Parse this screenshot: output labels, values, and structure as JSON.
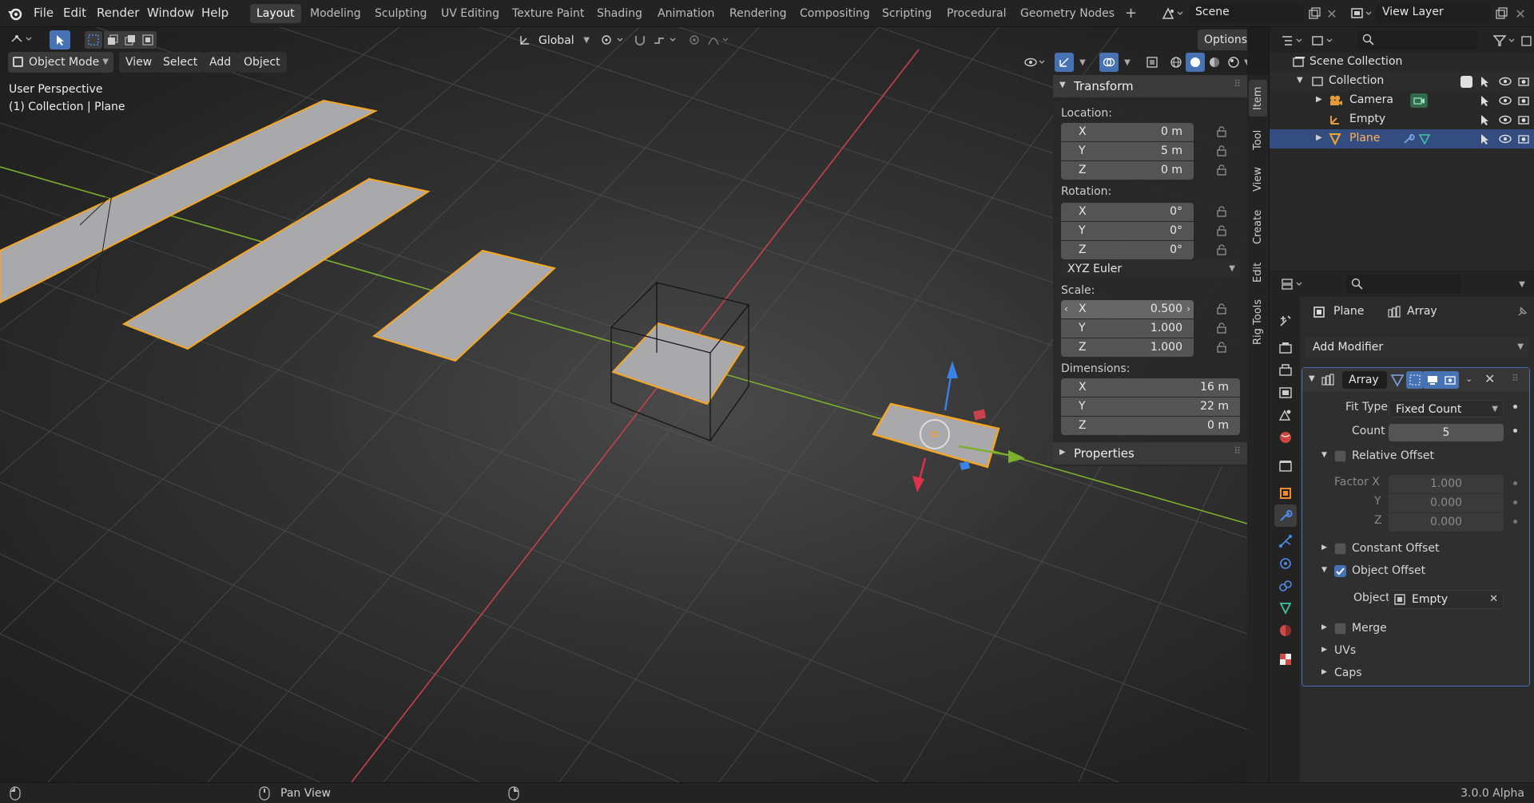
{
  "menu": [
    "File",
    "Edit",
    "Render",
    "Window",
    "Help"
  ],
  "workspaces": [
    "Layout",
    "Modeling",
    "Sculpting",
    "UV Editing",
    "Texture Paint",
    "Shading",
    "Animation",
    "Rendering",
    "Compositing",
    "Scripting",
    "Procedural",
    "Geometry Nodes"
  ],
  "active_workspace": "Layout",
  "scene": "Scene",
  "view_layer": "View Layer",
  "header": {
    "transform_orientation": "Global",
    "options": "Options"
  },
  "viewport_header": {
    "mode": "Object Mode",
    "view": "View",
    "select": "Select",
    "add": "Add",
    "object": "Object"
  },
  "viewport_info": {
    "perspective": "User Perspective",
    "collection": "(1) Collection | Plane"
  },
  "npanel": {
    "tabs": [
      "Item",
      "Tool",
      "View",
      "Create",
      "Edit",
      "Rig Tools"
    ],
    "transform_title": "Transform",
    "location_label": "Location:",
    "location": [
      {
        "axis": "X",
        "value": "0 m"
      },
      {
        "axis": "Y",
        "value": "5 m"
      },
      {
        "axis": "Z",
        "value": "0 m"
      }
    ],
    "rotation_label": "Rotation:",
    "rotation": [
      {
        "axis": "X",
        "value": "0°"
      },
      {
        "axis": "Y",
        "value": "0°"
      },
      {
        "axis": "Z",
        "value": "0°"
      }
    ],
    "rotation_mode": "XYZ Euler",
    "scale_label": "Scale:",
    "scale": [
      {
        "axis": "X",
        "value": "0.500"
      },
      {
        "axis": "Y",
        "value": "1.000"
      },
      {
        "axis": "Z",
        "value": "1.000"
      }
    ],
    "dimensions_label": "Dimensions:",
    "dimensions": [
      {
        "axis": "X",
        "value": "16 m"
      },
      {
        "axis": "Y",
        "value": "22 m"
      },
      {
        "axis": "Z",
        "value": "0 m"
      }
    ],
    "properties_title": "Properties"
  },
  "outliner": {
    "root": "Scene Collection",
    "collection": "Collection",
    "items": [
      "Camera",
      "Empty",
      "Plane"
    ]
  },
  "properties": {
    "object_name": "Plane",
    "modifier_name_crumb": "Array",
    "add_modifier": "Add Modifier",
    "modifier_name": "Array",
    "fit_type_label": "Fit Type",
    "fit_type": "Fixed Count",
    "count_label": "Count",
    "count": "5",
    "relative_offset": "Relative Offset",
    "factor_x_label": "Factor X",
    "factor_x": "1.000",
    "factor_y_label": "Y",
    "factor_y": "0.000",
    "factor_z_label": "Z",
    "factor_z": "0.000",
    "constant_offset": "Constant Offset",
    "object_offset": "Object Offset",
    "object_label": "Object",
    "object_value": "Empty",
    "merge": "Merge",
    "uvs": "UVs",
    "caps": "Caps"
  },
  "statusbar": {
    "pan_view": "Pan View",
    "version": "3.0.0 Alpha"
  },
  "colors": {
    "accent": "#4772b3",
    "selection_orange": "#f5a623",
    "x_axis": "#c8414b",
    "y_axis": "#7ab02c"
  }
}
